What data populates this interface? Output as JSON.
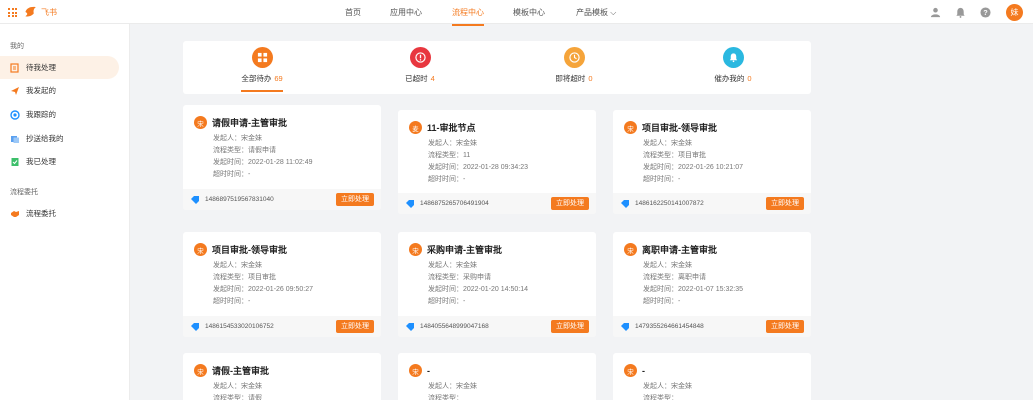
{
  "brand": {
    "name": "飞书",
    "accent": "#f47a1f"
  },
  "nav": {
    "items": [
      "首页",
      "应用中心",
      "流程中心",
      "模板中心",
      "产品模板"
    ],
    "active_index": 2
  },
  "user": {
    "avatar_text": "妹"
  },
  "sidebar": {
    "section_mine": "我的",
    "items_mine": [
      "待我处理",
      "我发起的",
      "我跟踪的",
      "抄送给我的",
      "我已处理"
    ],
    "section_delegate": "流程委托",
    "items_delegate": [
      "流程委托"
    ]
  },
  "stats": [
    {
      "label": "全部待办",
      "count": "69"
    },
    {
      "label": "已超时",
      "count": "4"
    },
    {
      "label": "即将超时",
      "count": "0"
    },
    {
      "label": "催办我的",
      "count": "0"
    }
  ],
  "field_labels": {
    "initiator": "发起人：",
    "type": "流程类型：",
    "time": "发起时间：",
    "timeout": "超时时间："
  },
  "action_label": "立即处理",
  "cards": [
    {
      "badge": "宋",
      "title": "请假申请-主管审批",
      "initiator": "宋金妹",
      "type": "请假申请",
      "time": "2022-01-28 11:02:49",
      "timeout": "-",
      "code": "1486897519567831040"
    },
    {
      "badge": "麦",
      "title": "11-审批节点",
      "initiator": "宋金妹",
      "type": "11",
      "time": "2022-01-28 09:34:23",
      "timeout": "-",
      "code": "1486875265706491904"
    },
    {
      "badge": "宋",
      "title": "项目审批-领导审批",
      "initiator": "宋金妹",
      "type": "项目审批",
      "time": "2022-01-26 10:21:07",
      "timeout": "-",
      "code": "1486162250141007872"
    },
    {
      "badge": "宋",
      "title": "项目审批-领导审批",
      "initiator": "宋金妹",
      "type": "项目审批",
      "time": "2022-01-26 09:50:27",
      "timeout": "-",
      "code": "1486154533020106752"
    },
    {
      "badge": "宋",
      "title": "采购申请-主管审批",
      "initiator": "宋金妹",
      "type": "采购申请",
      "time": "2022-01-20 14:50:14",
      "timeout": "-",
      "code": "1484055648999047168"
    },
    {
      "badge": "宋",
      "title": "离职申请-主管审批",
      "initiator": "宋金妹",
      "type": "离职申请",
      "time": "2022-01-07 15:32:35",
      "timeout": "-",
      "code": "1479355264661454848"
    },
    {
      "badge": "宋",
      "title": "请假-主管审批",
      "initiator": "宋金妹",
      "type": "请假"
    },
    {
      "badge": "宋",
      "title": "-",
      "initiator": "宋金妹"
    },
    {
      "badge": "宋",
      "title": "-",
      "initiator": "宋金妹"
    }
  ]
}
